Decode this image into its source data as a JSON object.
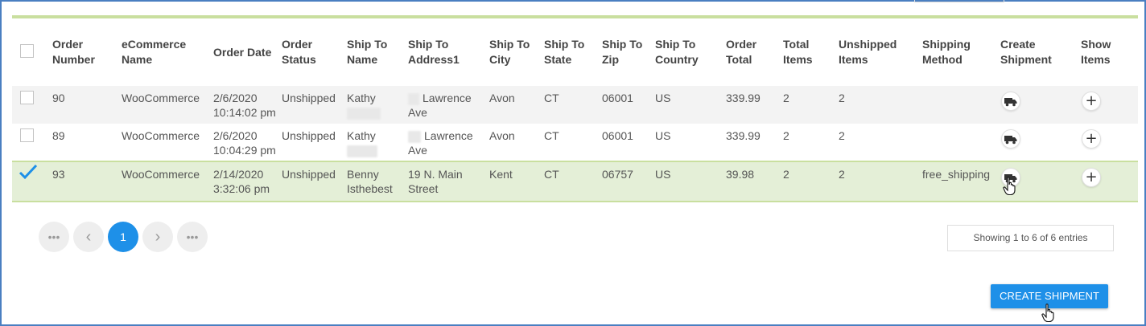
{
  "table": {
    "headers": {
      "order_number": "Order Number",
      "ecommerce_name": "eCommerce Name",
      "order_date": "Order Date",
      "order_status": "Order Status",
      "ship_to_name": "Ship To Name",
      "ship_to_address1": "Ship To Address1",
      "ship_to_city": "Ship To City",
      "ship_to_state": "Ship To State",
      "ship_to_zip": "Ship To Zip",
      "ship_to_country": "Ship To Country",
      "order_total": "Order Total",
      "total_items": "Total Items",
      "unshipped_items": "Unshipped Items",
      "shipping_method": "Shipping Method",
      "create_shipment": "Create Shipment",
      "show_items": "Show Items"
    },
    "rows": [
      {
        "selected": false,
        "order_number": "90",
        "ecommerce_name": "WooCommerce",
        "order_date": "2/6/2020",
        "order_time": "10:14:02 pm",
        "order_status": "Unshipped",
        "ship_to_name": "Kathy",
        "ship_to_address1": "Lawrence",
        "ship_to_address2": "Ave",
        "ship_to_city": "Avon",
        "ship_to_state": "CT",
        "ship_to_zip": "06001",
        "ship_to_country": "US",
        "order_total": "339.99",
        "total_items": "2",
        "unshipped_items": "2",
        "shipping_method": ""
      },
      {
        "selected": false,
        "order_number": "89",
        "ecommerce_name": "WooCommerce",
        "order_date": "2/6/2020",
        "order_time": "10:04:29 pm",
        "order_status": "Unshipped",
        "ship_to_name": "Kathy",
        "ship_to_address1": "Lawrence",
        "ship_to_address2": "Ave",
        "ship_to_city": "Avon",
        "ship_to_state": "CT",
        "ship_to_zip": "06001",
        "ship_to_country": "US",
        "order_total": "339.99",
        "total_items": "2",
        "unshipped_items": "2",
        "shipping_method": ""
      },
      {
        "selected": true,
        "order_number": "93",
        "ecommerce_name": "WooCommerce",
        "order_date": "2/14/2020",
        "order_time": "3:32:06 pm",
        "order_status": "Unshipped",
        "ship_to_name": "Benny",
        "ship_to_name2": "Isthebest",
        "ship_to_address1": "19 N. Main",
        "ship_to_address2": "Street",
        "ship_to_city": "Kent",
        "ship_to_state": "CT",
        "ship_to_zip": "06757",
        "ship_to_country": "US",
        "order_total": "39.98",
        "total_items": "2",
        "unshipped_items": "2",
        "shipping_method": "free_shipping"
      }
    ],
    "icons": {
      "create_shipment": "truck-icon",
      "show_items": "plus-icon",
      "selected": "checkmark-icon"
    }
  },
  "pagination": {
    "first": "•••",
    "prev": "‹",
    "current": "1",
    "next": "›",
    "last": "•••"
  },
  "entries_info": "Showing 1 to 6 of 6 entries",
  "create_shipment_button": "CREATE SHIPMENT",
  "colors": {
    "accent": "#1e90e8",
    "row_highlight": "#e4efd7",
    "green_bar": "#c9df9f",
    "frame_border": "#4a7fc1"
  }
}
